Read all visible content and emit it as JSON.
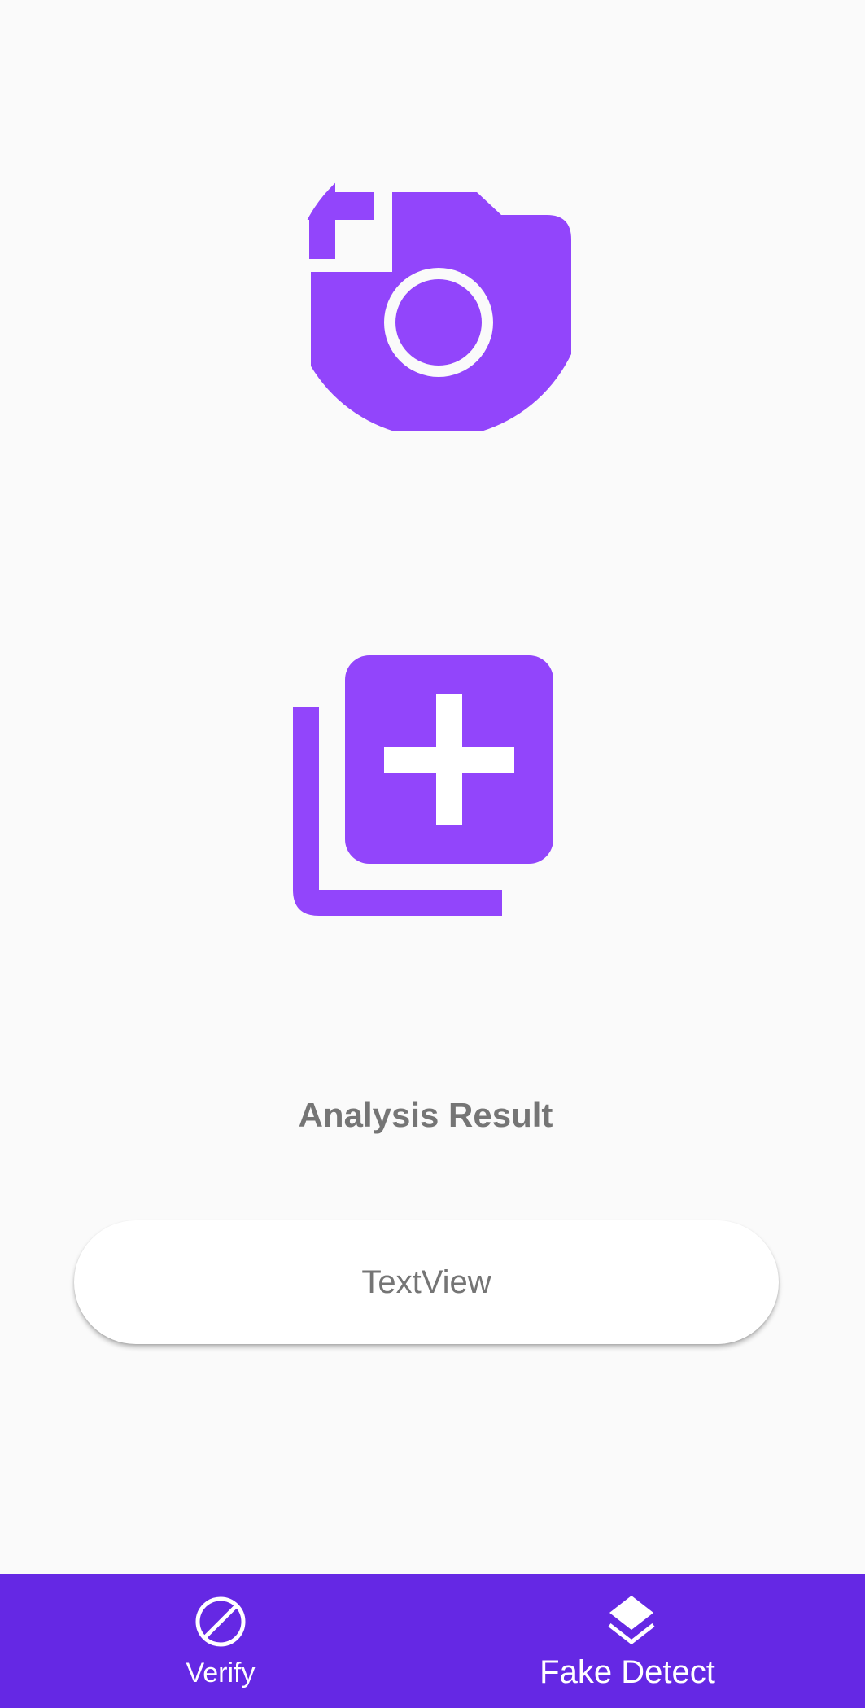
{
  "colors": {
    "accent": "#9245fb",
    "nav_background": "#6528e4",
    "background": "#fafafa",
    "text_gray": "#757575"
  },
  "actions": {
    "camera_icon": "add-a-photo-icon",
    "gallery_icon": "add-to-photos-icon"
  },
  "result": {
    "title": "Analysis Result",
    "text": "TextView"
  },
  "bottom_nav": {
    "items": [
      {
        "label": "Verify",
        "icon": "block-icon",
        "selected": false
      },
      {
        "label": "Fake Detect",
        "icon": "layers-icon",
        "selected": true
      }
    ]
  }
}
